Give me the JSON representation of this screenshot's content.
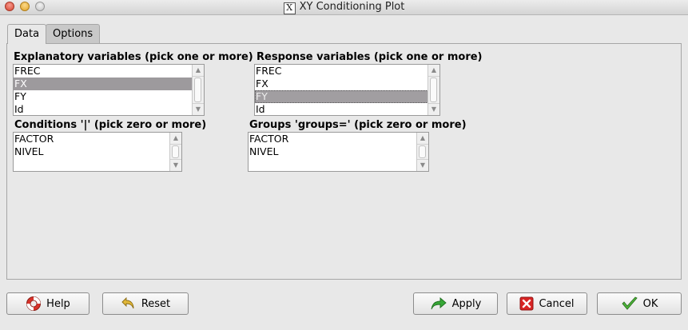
{
  "window": {
    "title": "XY Conditioning Plot"
  },
  "tabs": [
    {
      "label": "Data"
    },
    {
      "label": "Options"
    }
  ],
  "explanatory": {
    "label": "Explanatory variables (pick one or more)",
    "items": [
      "FREC",
      "FX",
      "FY",
      "Id"
    ]
  },
  "response": {
    "label": "Response variables (pick one or more)",
    "items": [
      "FREC",
      "FX",
      "FY",
      "Id"
    ]
  },
  "conditions": {
    "label": "Conditions '|' (pick zero or more)",
    "items": [
      "FACTOR",
      "NIVEL"
    ]
  },
  "groups": {
    "label": "Groups 'groups=' (pick zero or more)",
    "items": [
      "FACTOR",
      "NIVEL"
    ]
  },
  "buttons": {
    "help": "Help",
    "reset": "Reset",
    "apply": "Apply",
    "cancel": "Cancel",
    "ok": "OK"
  },
  "colors": {
    "selection": "#9d9a9d",
    "apply_arrow": "#2e9a2e",
    "cancel_x": "#d42020",
    "ok_check": "#3aa82f"
  }
}
